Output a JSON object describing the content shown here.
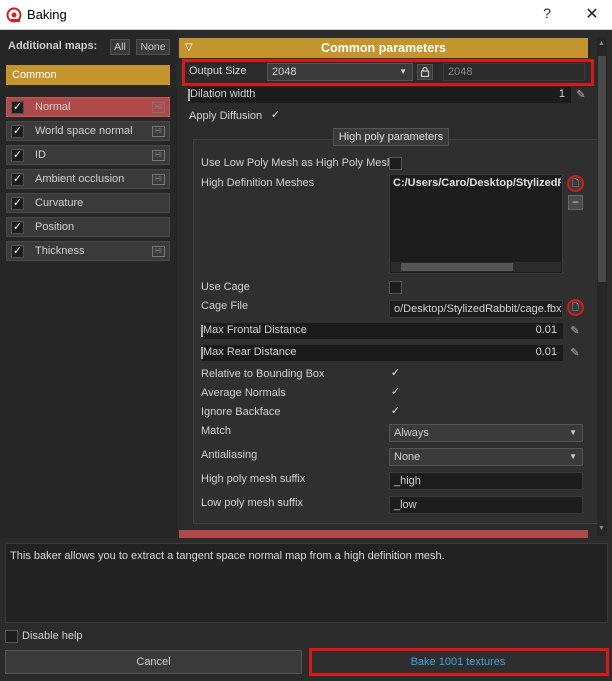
{
  "window": {
    "title": "Baking",
    "help": "?",
    "close": "✕"
  },
  "left": {
    "header": "Additional maps:",
    "all_label": "All",
    "none_label": "None",
    "group_label": "Common",
    "maps": [
      {
        "label": "Normal",
        "checked": true,
        "selected": true,
        "hi": "HI"
      },
      {
        "label": "World space normal",
        "checked": true,
        "selected": false,
        "hi": "HI"
      },
      {
        "label": "ID",
        "checked": true,
        "selected": false,
        "hi": "HI"
      },
      {
        "label": "Ambient occlusion",
        "checked": true,
        "selected": false,
        "hi": "HI"
      },
      {
        "label": "Curvature",
        "checked": true,
        "selected": false,
        "hi": ""
      },
      {
        "label": "Position",
        "checked": true,
        "selected": false,
        "hi": ""
      },
      {
        "label": "Thickness",
        "checked": true,
        "selected": false,
        "hi": "HI"
      }
    ]
  },
  "common": {
    "section_title": "Common parameters",
    "output_size_label": "Output Size",
    "output_size_value": "2048",
    "output_size_value2": "2048",
    "dilation_label": "Dilation width",
    "dilation_value": "1",
    "apply_diffusion_label": "Apply Diffusion",
    "apply_diffusion_checked": true
  },
  "highpoly": {
    "button_label": "High poly parameters",
    "use_low_poly_label": "Use Low Poly Mesh as High Poly Mesh",
    "use_low_poly_checked": false,
    "hd_meshes_label": "High Definition Meshes",
    "hd_mesh_path": "C:/Users/Caro/Desktop/StylizedRa",
    "use_cage_label": "Use Cage",
    "use_cage_checked": false,
    "cage_file_label": "Cage File",
    "cage_file_value": "o/Desktop/StylizedRabbit/cage.fbx",
    "max_frontal_label": "Max Frontal Distance",
    "max_frontal_value": "0.01",
    "max_rear_label": "Max Rear Distance",
    "max_rear_value": "0.01",
    "relative_bbox_label": "Relative to Bounding Box",
    "relative_bbox_checked": true,
    "average_normals_label": "Average Normals",
    "average_normals_checked": true,
    "ignore_backface_label": "Ignore Backface",
    "ignore_backface_checked": true,
    "match_label": "Match",
    "match_value": "Always",
    "antialiasing_label": "Antialiasing",
    "antialiasing_value": "None",
    "high_suffix_label": "High poly mesh suffix",
    "high_suffix_value": "_high",
    "low_suffix_label": "Low poly mesh suffix",
    "low_suffix_value": "_low"
  },
  "help_text": "This baker allows you to extract a tangent space normal map from a high definition mesh.",
  "disable_help_label": "Disable help",
  "cancel_label": "Cancel",
  "bake_label": "Bake 1001 textures",
  "colors": {
    "accent": "#c4952f",
    "selected": "#b04a4a",
    "highlight": "#d61a1a",
    "bake_text": "#3fa4e6"
  }
}
